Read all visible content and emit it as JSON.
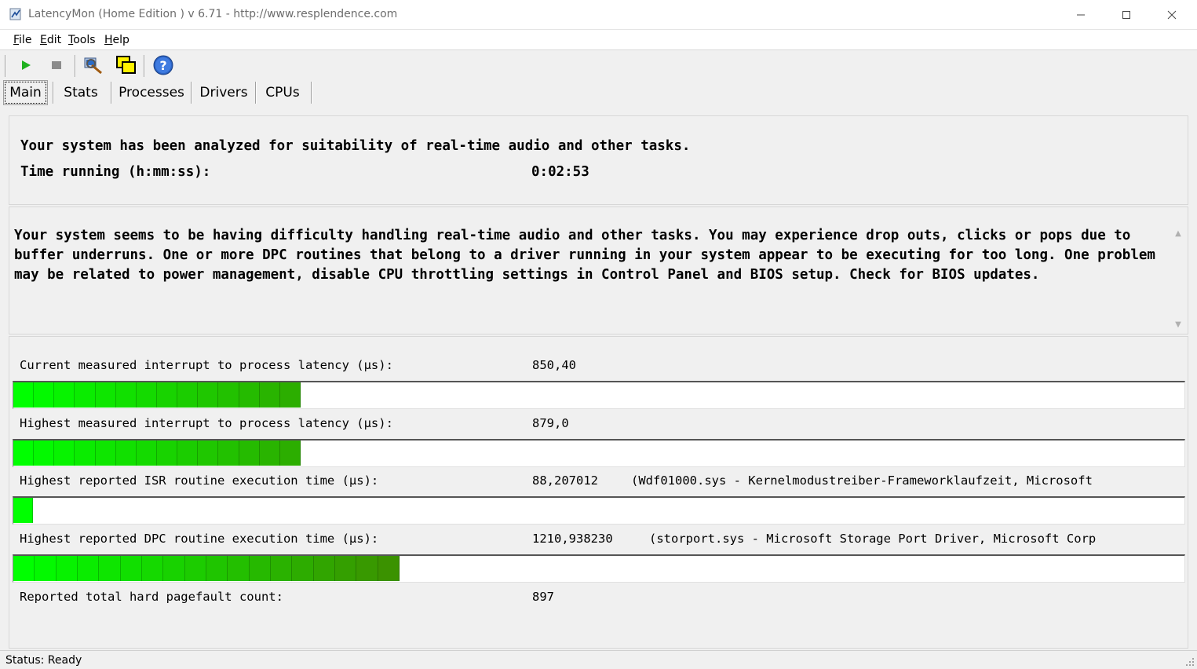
{
  "window": {
    "app_name": "LatencyMon",
    "title": "LatencyMon  (Home Edition )  v 6.71 - http://www.resplendence.com"
  },
  "menu": [
    {
      "label": "File",
      "key": "F",
      "rest": "ile"
    },
    {
      "label": "Edit",
      "key": "E",
      "rest": "dit"
    },
    {
      "label": "Tools",
      "key": "T",
      "rest": "ools"
    },
    {
      "label": "Help",
      "key": "H",
      "rest": "elp"
    }
  ],
  "toolbar": {
    "icons": [
      "start-icon",
      "stop-icon",
      "analyze-icon",
      "windows-icon",
      "help-icon"
    ]
  },
  "tabs": [
    {
      "label": "Main",
      "active": true
    },
    {
      "label": "Stats",
      "active": false
    },
    {
      "label": "Processes",
      "active": false
    },
    {
      "label": "Drivers",
      "active": false
    },
    {
      "label": "CPUs",
      "active": false
    }
  ],
  "summary": {
    "line1": "Your system has been analyzed for suitability of real-time audio and other tasks.",
    "time_label": "Time running (h:mm:ss):",
    "time_value": "0:02:53"
  },
  "message": "Your system seems to be having difficulty handling real-time audio and other tasks. You may experience drop outs, clicks or pops due to buffer underruns. One or more DPC routines that belong to a driver running in your system appear to be executing for too long. One problem may be related to power management, disable CPU throttling settings in Control Panel and BIOS setup. Check for BIOS updates.",
  "metrics": [
    {
      "label": "Current measured interrupt to process latency (µs):",
      "value": "850,40",
      "extra": "",
      "fill": 0.245,
      "segments": 14
    },
    {
      "label": "Highest measured interrupt to process latency (µs):",
      "value": "879,0",
      "extra": "",
      "fill": 0.245,
      "segments": 14
    },
    {
      "label": "Highest reported ISR routine execution time (µs):",
      "value": "88,207012",
      "extra": "(Wdf01000.sys - Kernelmodustreiber-Frameworklaufzeit, Microsoft",
      "fill": 0.017,
      "segments": 1
    },
    {
      "label": "Highest reported DPC routine execution time (µs):",
      "value": "1210,938230",
      "extra": "(storport.sys - Microsoft Storage Port Driver, Microsoft Corp",
      "fill": 0.33,
      "segments": 18
    }
  ],
  "pagefault": {
    "label": "Reported total hard pagefault count:",
    "value": "897"
  },
  "status": {
    "text": "Status: Ready"
  },
  "colors": {
    "bar_start": "#00ff00",
    "bar_end": "#5a5a00"
  }
}
